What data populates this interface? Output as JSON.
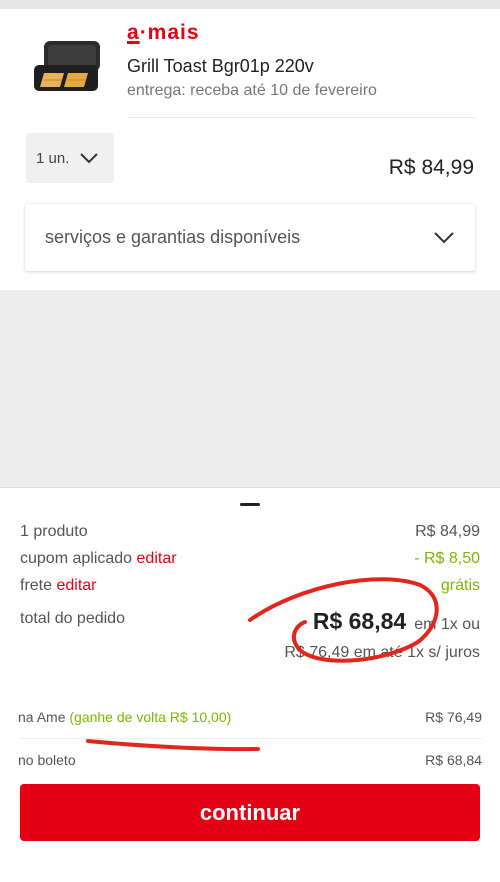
{
  "product": {
    "seller_logo_prefix": "a",
    "seller_logo_rest": "·mais",
    "name": "Grill Toast Bgr01p 220v",
    "delivery": "entrega: receba até 10 de fevereiro",
    "quantity": "1 un.",
    "price": "R$ 84,99",
    "services_label": "serviços e garantias disponíveis"
  },
  "summary": {
    "products_label": "1 produto",
    "products_value": "R$ 84,99",
    "coupon_label": "cupom aplicado",
    "coupon_edit": "editar",
    "coupon_value": "- R$ 8,50",
    "shipping_label": "frete",
    "shipping_edit": "editar",
    "shipping_value": "grátis",
    "total_label": "total do pedido",
    "total_value": "R$ 68,84",
    "total_terms": "em 1x ou",
    "alt_total": "R$ 76,49 em até 1x s/ juros"
  },
  "payment": {
    "ame_label": "na Ame",
    "ame_cashback": "(ganhe de volta R$ 10,00)",
    "ame_value": "R$ 76,49",
    "boleto_label": "no boleto",
    "boleto_value": "R$ 68,84"
  },
  "actions": {
    "continue_label": "continuar"
  },
  "colors": {
    "brand_red": "#e60014",
    "green": "#7ab800"
  }
}
